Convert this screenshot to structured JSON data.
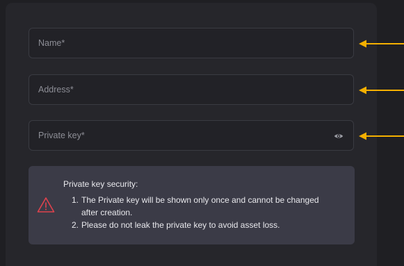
{
  "form": {
    "name_placeholder": "Name*",
    "name_value": "",
    "address_placeholder": "Address*",
    "address_value": "",
    "private_key_placeholder": "Private key*",
    "private_key_value": ""
  },
  "notice": {
    "title": "Private key security:",
    "items": [
      {
        "number": "1.",
        "text": "The Private key will be shown only once and cannot be changed after creation."
      },
      {
        "number": "2.",
        "text": "Please do not leak the private key to avoid asset loss."
      }
    ]
  },
  "icons": {
    "visibility": "eye-icon",
    "warning": "warning-triangle-icon",
    "annotation": "arrow-left-icon"
  },
  "colors": {
    "page_background": "#1f1f23",
    "panel_background": "#26262b",
    "field_border": "#3a3b42",
    "notice_background": "#3b3b47",
    "warning_red": "#e0424d",
    "annotation_arrow": "#f5b000",
    "placeholder_text": "#8d8e96"
  }
}
